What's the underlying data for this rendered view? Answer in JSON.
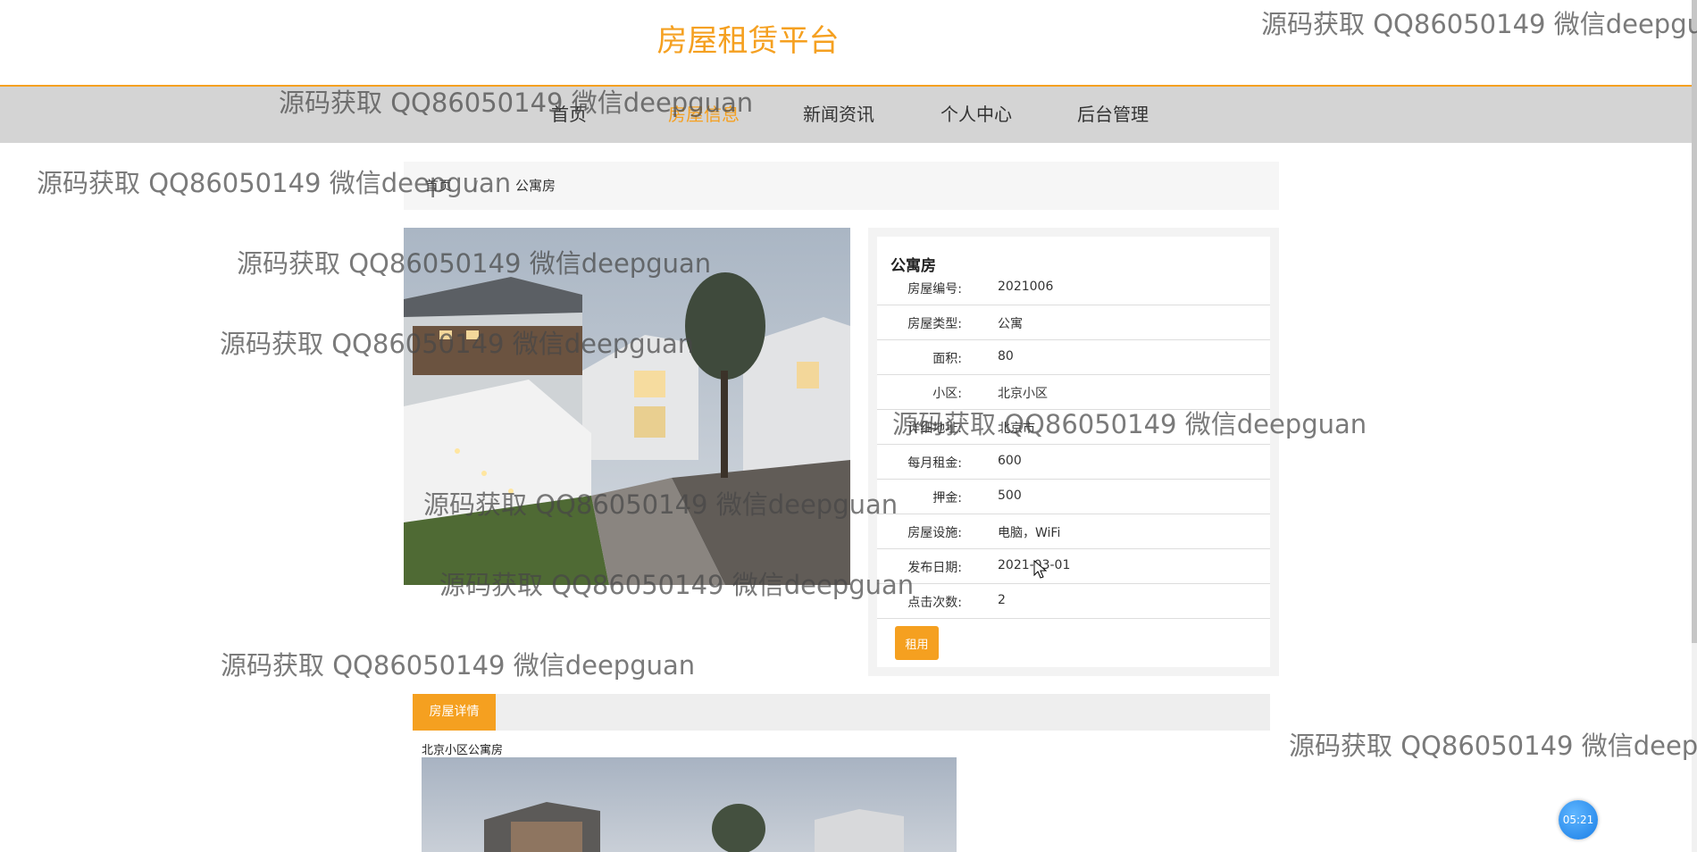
{
  "site": {
    "title": "房屋租赁平台"
  },
  "nav": {
    "items": [
      "首页",
      "房屋信息",
      "新闻资讯",
      "个人中心",
      "后台管理"
    ],
    "active": "房屋信息"
  },
  "breadcrumb": {
    "home": "首页",
    "separator": "/",
    "current": "公寓房"
  },
  "house": {
    "name": "公寓房",
    "fields": [
      {
        "label": "房屋编号:",
        "value": "2021006"
      },
      {
        "label": "房屋类型:",
        "value": "公寓"
      },
      {
        "label": "面积:",
        "value": "80"
      },
      {
        "label": "小区:",
        "value": "北京小区"
      },
      {
        "label": "详细地址:",
        "value": "北京市"
      },
      {
        "label": "每月租金:",
        "value": "600"
      },
      {
        "label": "押金:",
        "value": "500"
      },
      {
        "label": "房屋设施:",
        "value": "电脑，WiFi"
      },
      {
        "label": "发布日期:",
        "value": "2021-03-01"
      },
      {
        "label": "点击次数:",
        "value": "2"
      }
    ],
    "rent_button": "租用"
  },
  "details": {
    "tab_label": "房屋详情",
    "description": "北京小区公寓房"
  },
  "timer": "05:21",
  "watermark": "源码获取 QQ86050149 微信deepguan",
  "colors": {
    "accent": "#f5a020",
    "nav_bg": "#d4d4d4"
  }
}
